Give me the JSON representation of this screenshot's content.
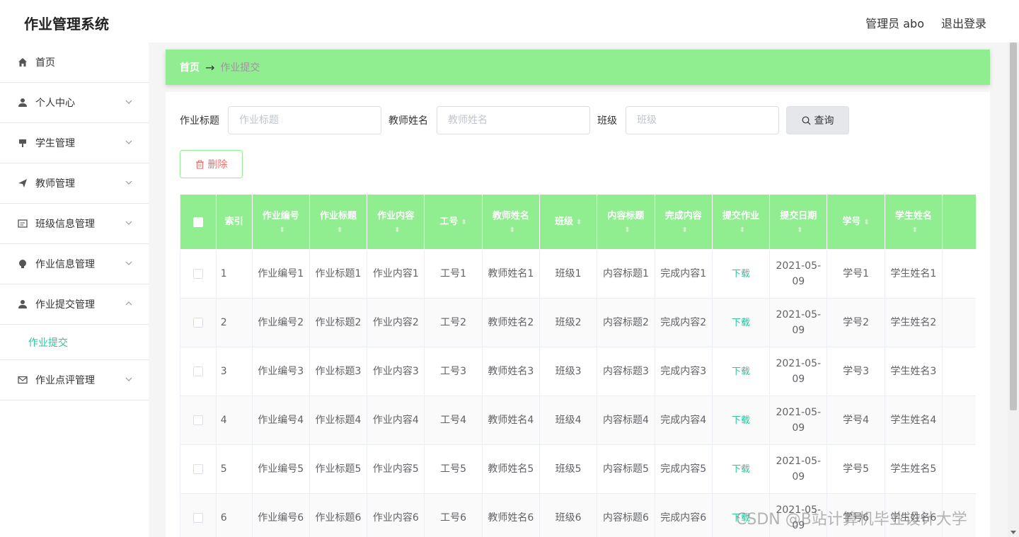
{
  "header": {
    "app_title": "作业管理系统",
    "user": "管理员 abo",
    "logout": "退出登录"
  },
  "sidebar": {
    "items": [
      {
        "label": "首页",
        "icon": "home-icon"
      },
      {
        "label": "个人中心",
        "icon": "user-icon"
      },
      {
        "label": "学生管理",
        "icon": "flag-icon"
      },
      {
        "label": "教师管理",
        "icon": "send-icon"
      },
      {
        "label": "班级信息管理",
        "icon": "tickets-icon"
      },
      {
        "label": "作业信息管理",
        "icon": "bulb-icon"
      },
      {
        "label": "作业提交管理",
        "icon": "user-icon"
      },
      {
        "label": "作业点评管理",
        "icon": "message-icon"
      }
    ],
    "sub_item": "作业提交"
  },
  "breadcrumb": {
    "home": "首页",
    "separator": "→",
    "current": "作业提交"
  },
  "search": {
    "title_label": "作业标题",
    "title_placeholder": "作业标题",
    "teacher_label": "教师姓名",
    "teacher_placeholder": "教师姓名",
    "class_label": "班级",
    "class_placeholder": "班级",
    "query_button": "查询"
  },
  "delete_button": "删除",
  "table": {
    "headers": [
      "索引",
      "作业编号",
      "作业标题",
      "作业内容",
      "工号",
      "教师姓名",
      "班级",
      "内容标题",
      "完成内容",
      "提交作业",
      "提交日期",
      "学号",
      "学生姓名"
    ],
    "rows": [
      [
        "1",
        "作业编号1",
        "作业标题1",
        "作业内容1",
        "工号1",
        "教师姓名1",
        "班级1",
        "内容标题1",
        "完成内容1",
        "下载",
        "2021-05-09",
        "学号1",
        "学生姓名1"
      ],
      [
        "2",
        "作业编号2",
        "作业标题2",
        "作业内容2",
        "工号2",
        "教师姓名2",
        "班级2",
        "内容标题2",
        "完成内容2",
        "下载",
        "2021-05-09",
        "学号2",
        "学生姓名2"
      ],
      [
        "3",
        "作业编号3",
        "作业标题3",
        "作业内容3",
        "工号3",
        "教师姓名3",
        "班级3",
        "内容标题3",
        "完成内容3",
        "下载",
        "2021-05-09",
        "学号3",
        "学生姓名3"
      ],
      [
        "4",
        "作业编号4",
        "作业标题4",
        "作业内容4",
        "工号4",
        "教师姓名4",
        "班级4",
        "内容标题4",
        "完成内容4",
        "下载",
        "2021-05-09",
        "学号4",
        "学生姓名4"
      ],
      [
        "5",
        "作业编号5",
        "作业标题5",
        "作业内容5",
        "工号5",
        "教师姓名5",
        "班级5",
        "内容标题5",
        "完成内容5",
        "下载",
        "2021-05-09",
        "学号5",
        "学生姓名5"
      ],
      [
        "6",
        "作业编号6",
        "作业标题6",
        "作业内容6",
        "工号6",
        "教师姓名6",
        "班级6",
        "内容标题6",
        "完成内容6",
        "下载",
        "2021-05-09",
        "学号6",
        "学生姓名6"
      ]
    ]
  },
  "watermark": "CSDN @B站计算机毕业设计大学",
  "colors": {
    "accent": "#90ee90",
    "link": "#2ec4a0",
    "danger": "#f56c6c"
  }
}
